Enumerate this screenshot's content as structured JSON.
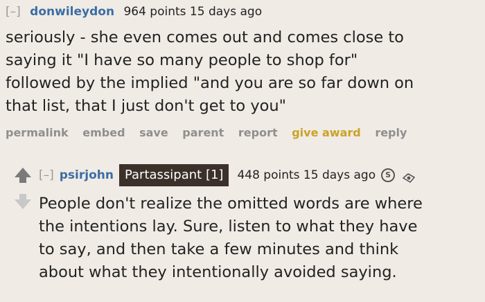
{
  "comment1": {
    "toggle": "[–]",
    "author": "donwileydon",
    "meta": "964 points 15 days ago",
    "body_lines": [
      "seriously - she even comes out and comes close to",
      "saying it \"I have so many people to shop for\"",
      "followed by the implied \"and you are so far down on",
      "that list, that I just don't get to you\""
    ],
    "actions": {
      "permalink": "permalink",
      "embed": "embed",
      "save": "save",
      "parent": "parent",
      "report": "report",
      "give_award": "give award",
      "reply": "reply"
    }
  },
  "comment2": {
    "toggle": "[–]",
    "author": "psirjohn",
    "flair": "Partassipant [1]",
    "meta": "448 points 15 days ago",
    "body_lines": [
      "People don't realize the omitted words are where",
      "the intentions lay. Sure, listen to what they have",
      "to say, and then take a few minutes and think",
      "about what they intentionally avoided saying."
    ],
    "icons": {
      "s_icon": "S"
    }
  },
  "colors": {
    "background": "#f0ebe5",
    "author": "#3a6ea5",
    "award": "#c9a227",
    "flair_bg": "#3b302a"
  }
}
